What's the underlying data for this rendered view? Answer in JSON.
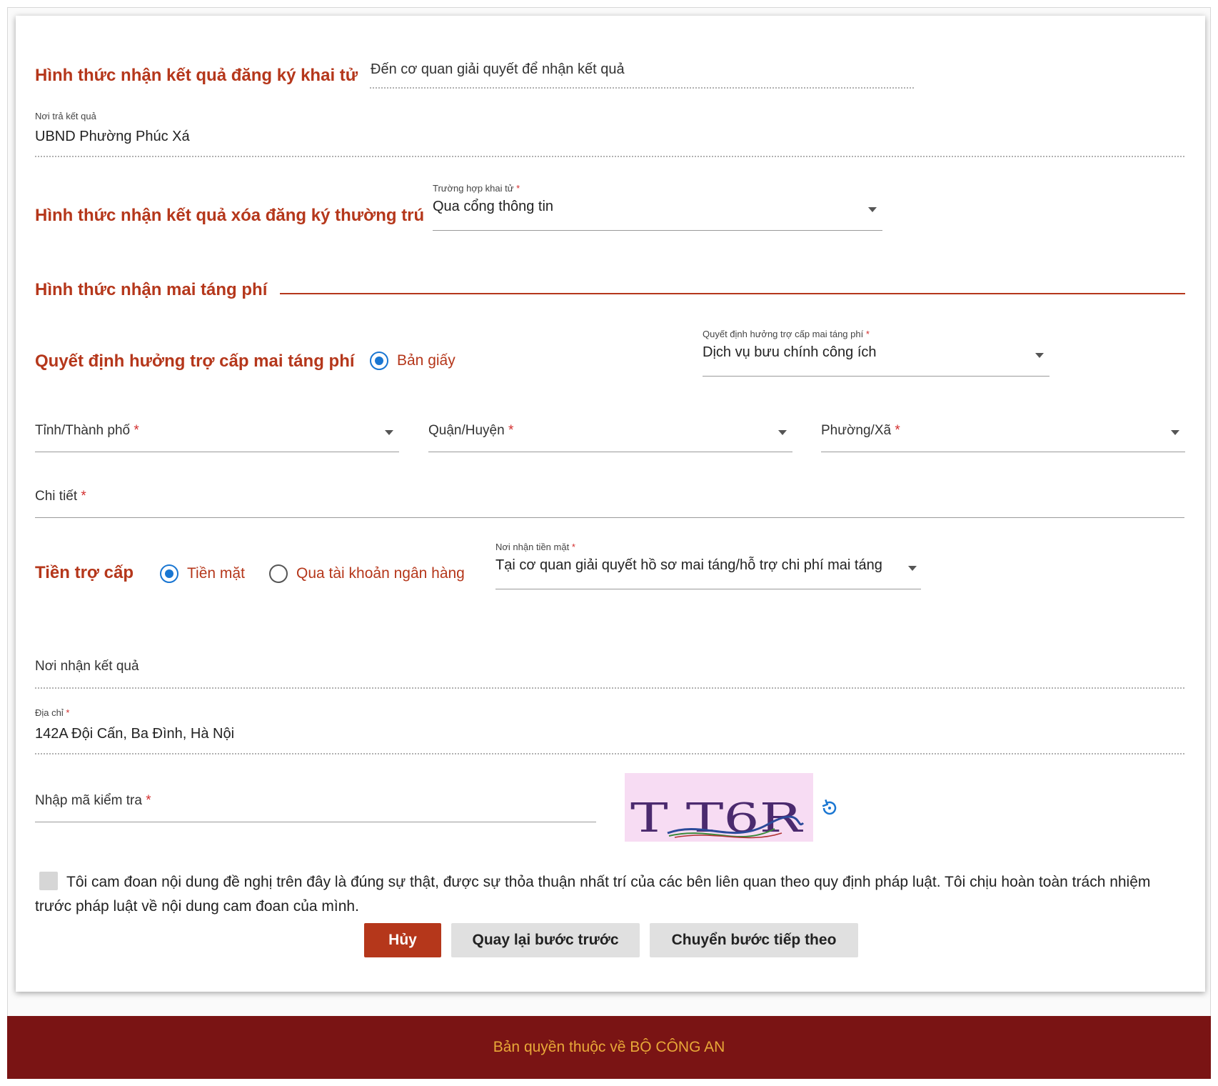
{
  "section1": {
    "title": "Hình thức nhận kết quả đăng ký khai tử",
    "value": "Đến cơ quan giải quyết để nhận kết quả"
  },
  "return_place": {
    "label": "Nơi trả kết quả",
    "value": "UBND Phường Phúc Xá"
  },
  "section2": {
    "title": "Hình thức nhận kết quả xóa đăng ký thường trú",
    "select_label": "Trường hợp khai tử",
    "select_value": "Qua cổng thông tin"
  },
  "section3": {
    "title": "Hình thức nhận mai táng phí"
  },
  "decision": {
    "title": "Quyết định hưởng trợ cấp mai táng phí",
    "radio_label": "Bản giấy",
    "select_label": "Quyết định hưởng trợ cấp mai táng phí",
    "select_value": "Dịch vụ bưu chính công ích"
  },
  "address": {
    "province_label": "Tỉnh/Thành phố",
    "district_label": "Quận/Huyện",
    "ward_label": "Phường/Xã",
    "detail_label": "Chi tiết"
  },
  "allowance": {
    "title": "Tiền trợ cấp",
    "option_cash": "Tiền mặt",
    "option_bank": "Qua tài khoản ngân hàng",
    "select_label": "Nơi nhận tiền mặt",
    "select_value": "Tại cơ quan giải quyết hồ sơ mai táng/hỗ trợ chi phí mai táng"
  },
  "result_place": {
    "label": "Nơi nhận kết quả"
  },
  "addr_field": {
    "label": "Địa chỉ",
    "value": "142A Đội Cấn, Ba Đình, Hà Nội"
  },
  "captcha": {
    "label": "Nhập mã kiểm tra",
    "code": "T T6R"
  },
  "commitment": {
    "text": "Tôi cam đoan nội dung đề nghị trên đây là đúng sự thật, được sự thỏa thuận nhất trí của các bên liên quan theo quy định pháp luật. Tôi chịu hoàn toàn trách nhiệm trước pháp luật về nội dung cam đoan của mình."
  },
  "buttons": {
    "cancel": "Hủy",
    "back": "Quay lại bước trước",
    "next": "Chuyển bước tiếp theo"
  },
  "footer": {
    "text": "Bản quyền thuộc về BỘ CÔNG AN"
  },
  "colors": {
    "accent": "#b5371b",
    "radio": "#1976d2",
    "footer_bg": "#7a1414",
    "footer_text": "#e8a838"
  }
}
